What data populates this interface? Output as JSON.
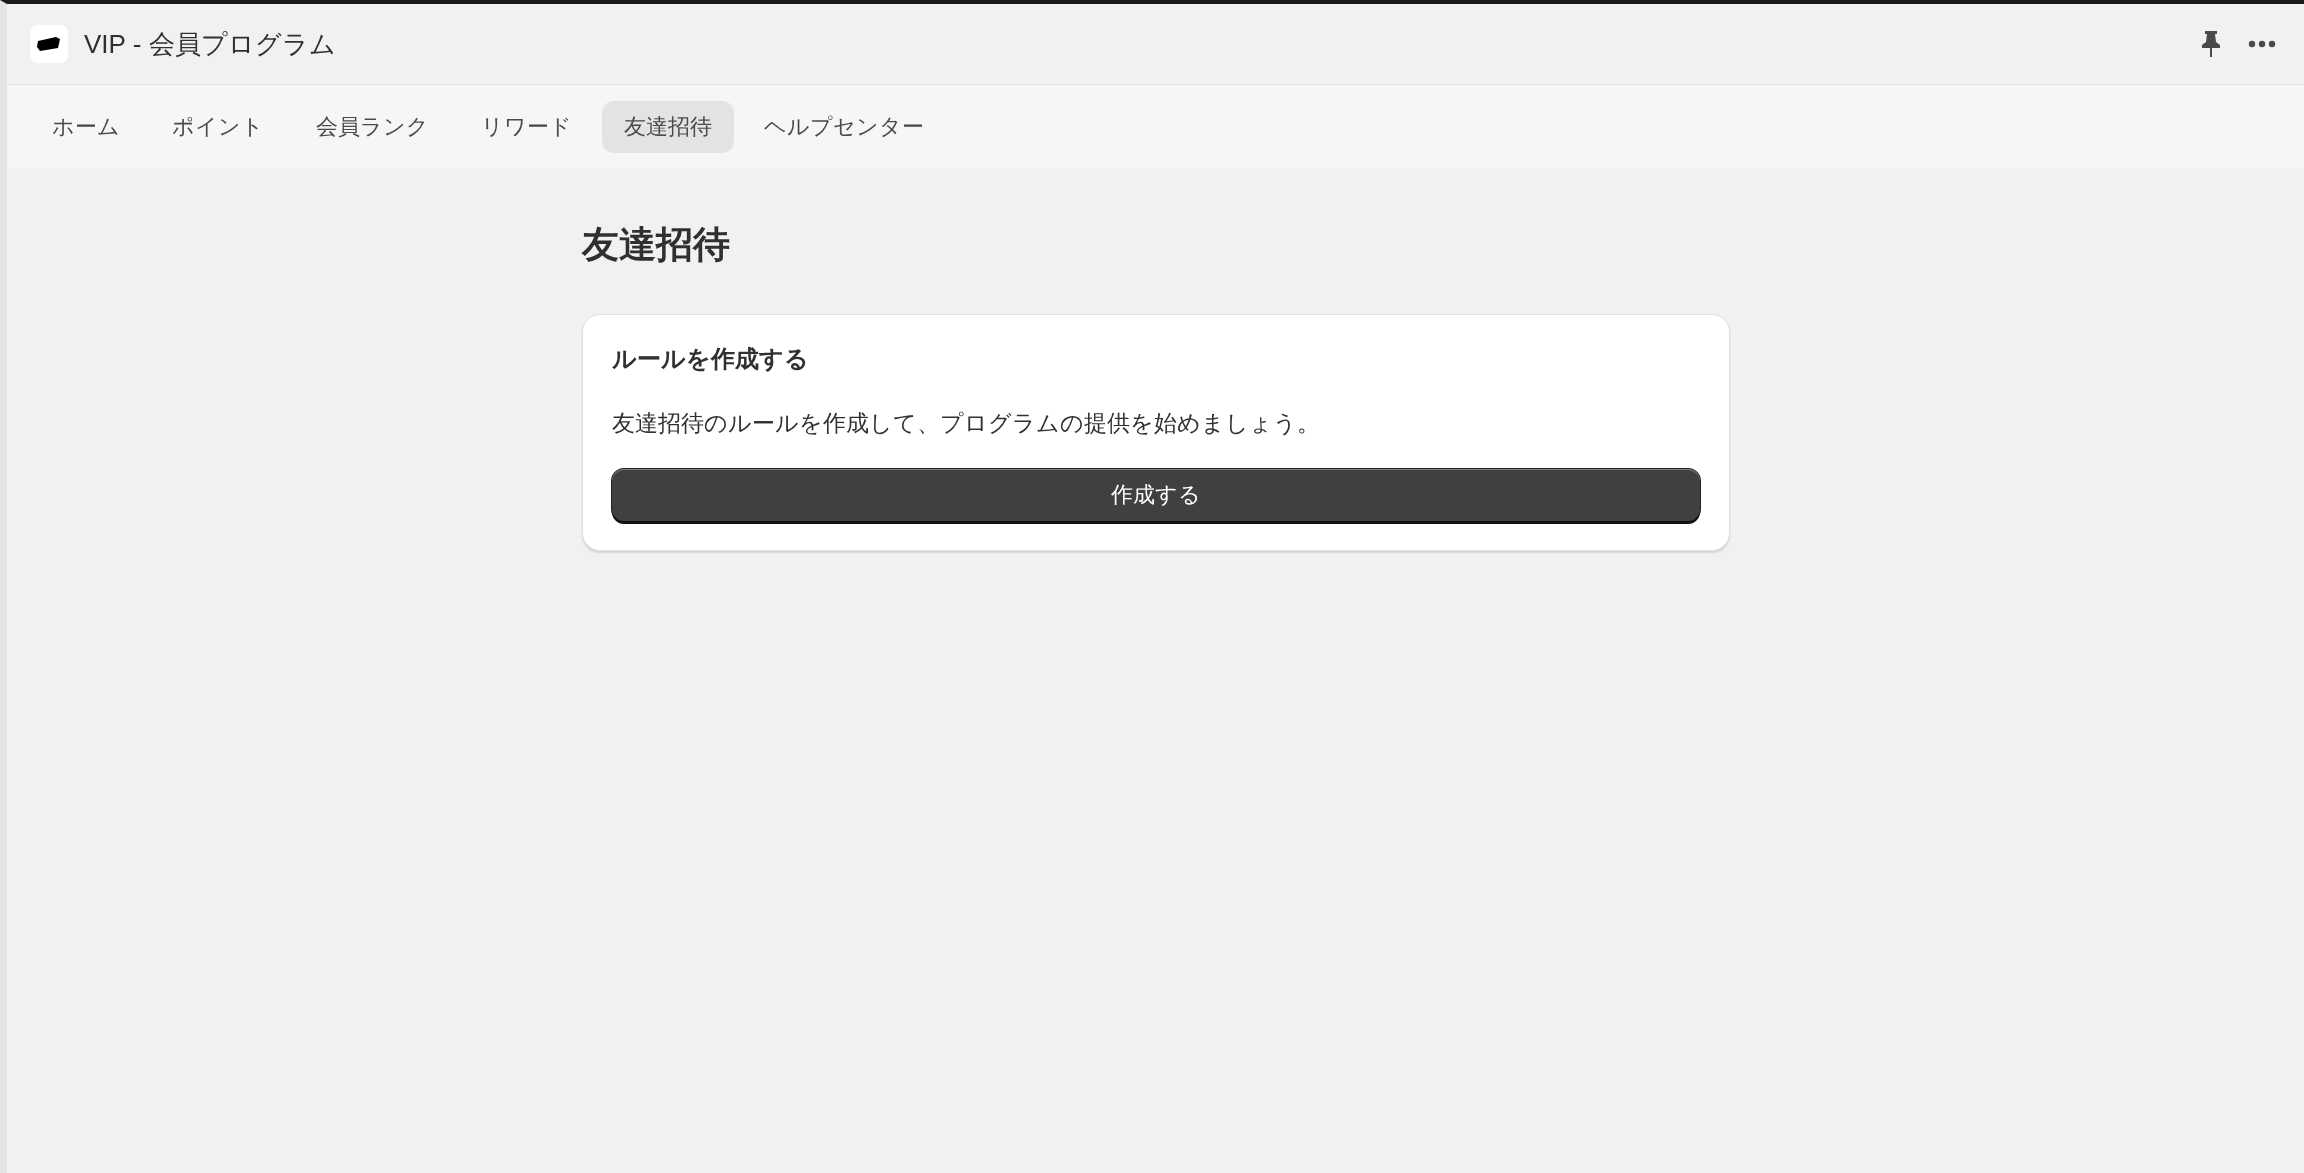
{
  "window": {
    "title": "VIP - 会員プログラム"
  },
  "tabs": [
    {
      "label": "ホーム",
      "selected": false
    },
    {
      "label": "ポイント",
      "selected": false
    },
    {
      "label": "会員ランク",
      "selected": false
    },
    {
      "label": "リワード",
      "selected": false
    },
    {
      "label": "友達招待",
      "selected": true
    },
    {
      "label": "ヘルプセンター",
      "selected": false
    }
  ],
  "page": {
    "title": "友達招待"
  },
  "card": {
    "title": "ルールを作成する",
    "description": "友達招待のルールを作成して、プログラムの提供を始めましょう。",
    "button": "作成する"
  }
}
